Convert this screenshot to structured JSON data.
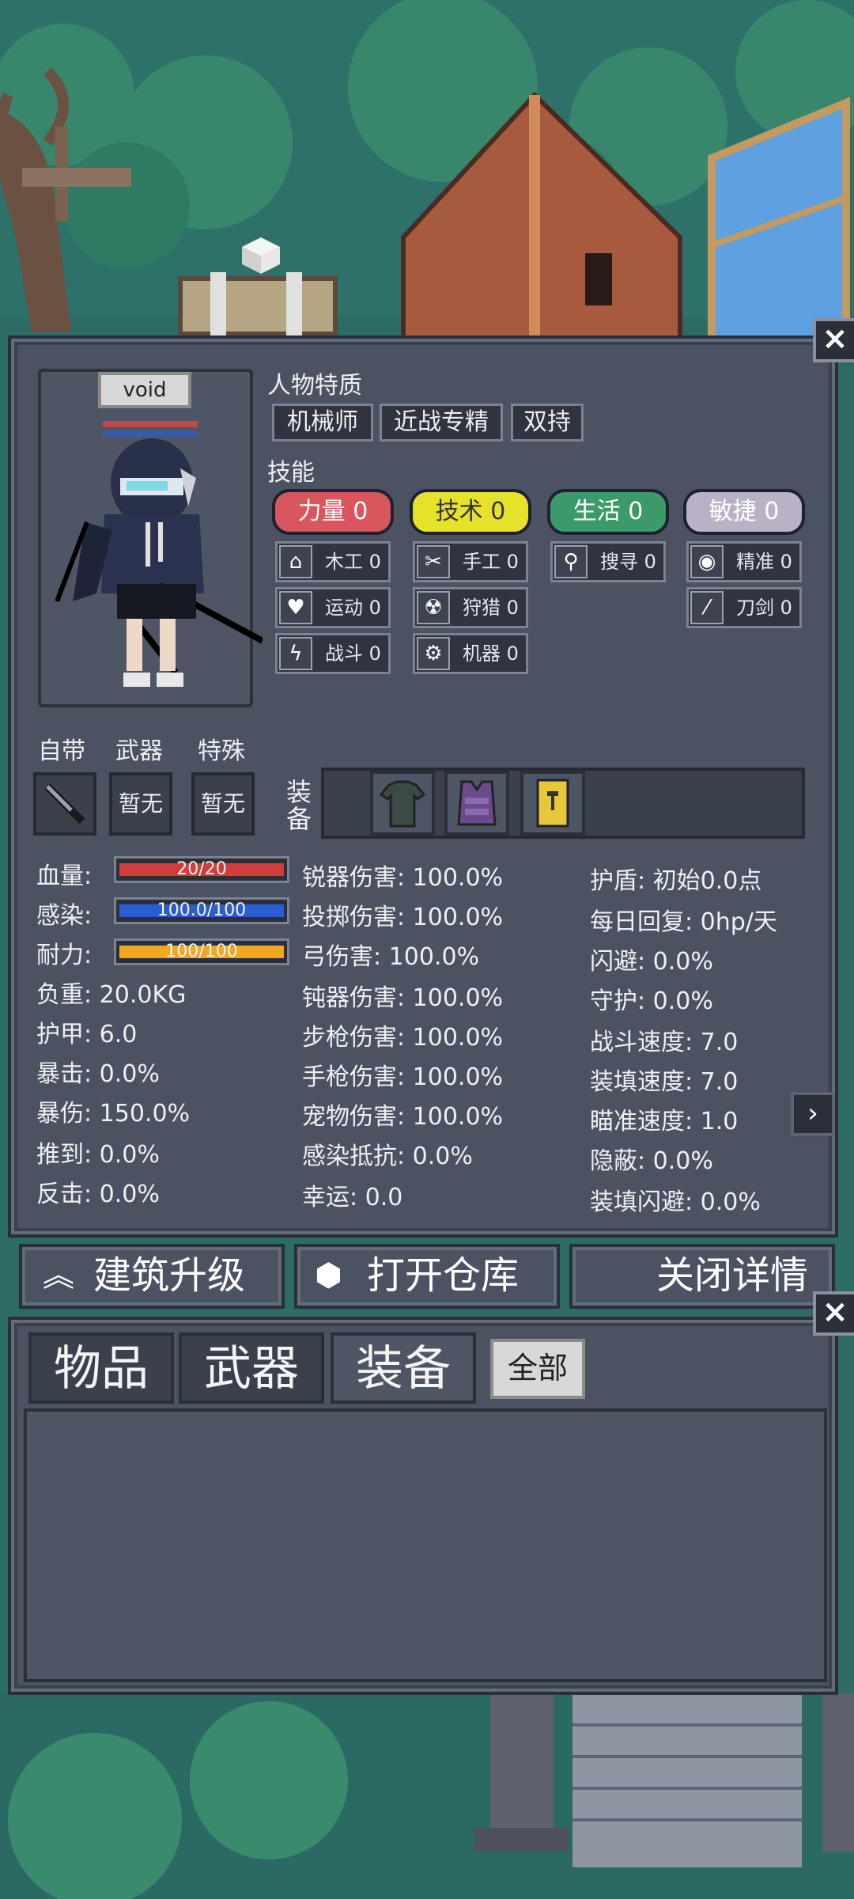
{
  "character": {
    "name": "void",
    "traits_title": "人物特质",
    "traits": [
      "机械师",
      "近战专精",
      "双持"
    ],
    "skills_title": "技能"
  },
  "skill_groups": [
    {
      "label": "力量",
      "value": "0",
      "color": "#d9565e"
    },
    {
      "label": "技术",
      "value": "0",
      "color": "#e6e22a"
    },
    {
      "label": "生活",
      "value": "0",
      "color": "#3c9a6a"
    },
    {
      "label": "敏捷",
      "value": "0",
      "color": "#b9b2c7"
    }
  ],
  "sub_skills": [
    {
      "label": "木工",
      "value": "0",
      "icon": "house-icon"
    },
    {
      "label": "手工",
      "value": "0",
      "icon": "scissors-icon"
    },
    {
      "label": "搜寻",
      "value": "0",
      "icon": "magnifier-icon"
    },
    {
      "label": "精准",
      "value": "0",
      "icon": "eye-icon"
    },
    {
      "label": "运动",
      "value": "0",
      "icon": "heart-icon"
    },
    {
      "label": "狩猎",
      "value": "0",
      "icon": "radiation-icon"
    },
    {
      "label": "刀剑",
      "value": "0",
      "icon": "sword-icon"
    },
    {
      "label": "战斗",
      "value": "0",
      "icon": "axe-icon"
    },
    {
      "label": "机器",
      "value": "0",
      "icon": "gear-icon"
    }
  ],
  "slots": {
    "builtin_label": "自带",
    "weapon_label": "武器",
    "special_label": "特殊",
    "weapon_value": "暂无",
    "special_value": "暂无",
    "equip_label_1": "装",
    "equip_label_2": "备"
  },
  "vitals": {
    "hp_label": "血量:",
    "hp_value": "20/20",
    "hp_fraction": 1.0,
    "infection_label": "感染:",
    "infection_value": "100.0/100",
    "infection_fraction": 1.0,
    "stamina_label": "耐力:",
    "stamina_value": "100/100",
    "stamina_fraction": 1.0
  },
  "stats_col1": [
    {
      "label": "负重:",
      "value": "20.0KG"
    },
    {
      "label": "护甲:",
      "value": "6.0"
    },
    {
      "label": "暴击:",
      "value": "0.0%"
    },
    {
      "label": "暴伤:",
      "value": "150.0%"
    },
    {
      "label": "推到:",
      "value": "0.0%"
    },
    {
      "label": "反击:",
      "value": "0.0%"
    }
  ],
  "stats_col2": [
    {
      "label": "锐器伤害:",
      "value": "100.0%"
    },
    {
      "label": "投掷伤害:",
      "value": "100.0%"
    },
    {
      "label": "弓伤害:",
      "value": "100.0%"
    },
    {
      "label": "钝器伤害:",
      "value": "100.0%"
    },
    {
      "label": "步枪伤害:",
      "value": "100.0%"
    },
    {
      "label": "手枪伤害:",
      "value": "100.0%"
    },
    {
      "label": "宠物伤害:",
      "value": "100.0%"
    },
    {
      "label": "感染抵抗:",
      "value": "0.0%"
    },
    {
      "label": "幸运:",
      "value": "0.0"
    }
  ],
  "stats_col3": [
    {
      "label": "护盾:",
      "value": "初始0.0点"
    },
    {
      "label": "每日回复:",
      "value": "0hp/天"
    },
    {
      "label": "闪避:",
      "value": "0.0%"
    },
    {
      "label": "守护:",
      "value": "0.0%"
    },
    {
      "label": "战斗速度:",
      "value": "7.0"
    },
    {
      "label": "装填速度:",
      "value": "7.0"
    },
    {
      "label": "瞄准速度:",
      "value": "1.0"
    },
    {
      "label": "隐蔽:",
      "value": "0.0%"
    },
    {
      "label": "装填闪避:",
      "value": "0.0%"
    }
  ],
  "actions": {
    "upgrade": "建筑升级",
    "warehouse": "打开仓库",
    "close_details": "关闭详情"
  },
  "inventory": {
    "tabs": [
      "物品",
      "武器",
      "装备"
    ],
    "filter": "全部"
  },
  "icons": {
    "close": "×",
    "next": "›"
  }
}
